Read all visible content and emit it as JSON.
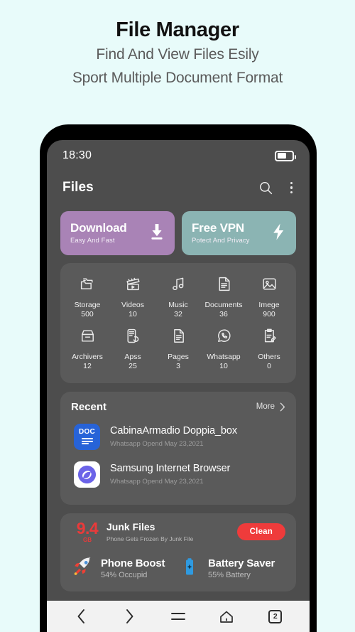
{
  "promo": {
    "title": "File Manager",
    "subtitle_line1": "Find And View Files Esily",
    "subtitle_line2": "Sport Multiple Document Format"
  },
  "statusbar": {
    "time": "18:30",
    "battery_icon": "battery-icon",
    "battery_level": "62"
  },
  "appbar": {
    "title": "Files",
    "search_icon": "search-icon",
    "menu_icon": "overflow-menu-icon"
  },
  "promo_cards": [
    {
      "title": "Download",
      "subtitle": "Easy And Fast",
      "icon": "download-icon",
      "color": "#a983b6"
    },
    {
      "title": "Free VPN",
      "subtitle": "Potect And Privacy",
      "icon": "lightning-bolt-icon",
      "color": "#8bb4b3"
    }
  ],
  "categories": [
    {
      "label": "Storage",
      "count": "500",
      "icon": "folders-icon"
    },
    {
      "label": "Videos",
      "count": "10",
      "icon": "clapperboard-icon"
    },
    {
      "label": "Music",
      "count": "32",
      "icon": "music-note-icon"
    },
    {
      "label": "Documents",
      "count": "36",
      "icon": "document-icon"
    },
    {
      "label": "Imege",
      "count": "900",
      "icon": "image-icon"
    },
    {
      "label": "Archivers",
      "count": "12",
      "icon": "archive-box-icon"
    },
    {
      "label": "Apss",
      "count": "25",
      "icon": "apps-icon"
    },
    {
      "label": "Pages",
      "count": "3",
      "icon": "page-icon"
    },
    {
      "label": "Whatsapp",
      "count": "10",
      "icon": "whatsapp-icon"
    },
    {
      "label": "Others",
      "count": "0",
      "icon": "clipboard-edit-icon"
    }
  ],
  "recent": {
    "title": "Recent",
    "more_label": "More",
    "more_icon": "chevron-right-icon",
    "items": [
      {
        "name": "CabinaArmadio Doppia_box",
        "meta": "Whatsapp Opend May 23,2021",
        "icon": "doc-file-icon",
        "icon_label": "DOC"
      },
      {
        "name": "Samsung Internet Browser",
        "meta": "Whatsapp Opend May 23,2021",
        "icon": "samsung-internet-icon"
      }
    ]
  },
  "junk": {
    "size_value": "9.4",
    "size_unit": "GB",
    "title": "Junk Files",
    "subtitle": "Phone Gets Frozen By Junk File",
    "clean_label": "Clean",
    "clean_color": "#ef3b3b"
  },
  "tools": [
    {
      "title": "Phone Boost",
      "subtitle": "54% Occupid",
      "icon": "rocket-icon"
    },
    {
      "title": "Battery Saver",
      "subtitle": "55% Battery",
      "icon": "battery-charge-icon"
    }
  ],
  "navbar": {
    "back_icon": "chevron-left-icon",
    "forward_icon": "chevron-right-icon",
    "menu_icon": "hamburger-menu-icon",
    "home_icon": "home-icon",
    "tabs_count": "2"
  }
}
